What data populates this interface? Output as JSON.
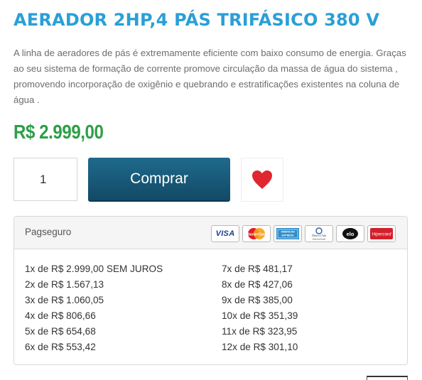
{
  "product": {
    "title": "AERADOR 2HP,4 PÁS TRIFÁSICO 380 V",
    "description": "A linha de aeradores de pás  é extremamente eficiente com baixo consumo de energia. Graças ao seu sistema de formação de corrente  promove circulação  da massa de água do sistema , promovendo incorporação de  oxigênio e quebrando e estratificações existentes na coluna de água .",
    "price": "R$ 2.999,00"
  },
  "purchase": {
    "quantity": "1",
    "buy_label": "Comprar",
    "wishlist_icon": "heart-icon",
    "accent_color": "#1a5d7e",
    "heart_color": "#e0262f"
  },
  "payment": {
    "provider": "Pagseguro",
    "cards": [
      {
        "name": "visa-icon",
        "label": "VISA"
      },
      {
        "name": "mastercard-icon",
        "label": "MasterCard"
      },
      {
        "name": "american-express-icon",
        "label": "AMERICAN EXPRESS"
      },
      {
        "name": "diners-club-icon",
        "label": "Diners Club International"
      },
      {
        "name": "elo-icon",
        "label": "elo"
      },
      {
        "name": "hipercard-icon",
        "label": "Hipercard"
      }
    ],
    "installments": [
      "1x de R$ 2.999,00 SEM JUROS",
      "7x de R$ 481,17",
      "2x de R$ 1.567,13",
      "8x de R$ 427,06",
      "3x de R$ 1.060,05",
      "9x de R$ 385,00",
      "4x de R$ 806,66",
      "10x de R$ 351,39",
      "5x de R$ 654,68",
      "11x de R$ 323,95",
      "6x de R$ 553,42",
      "12x de R$ 301,10"
    ]
  }
}
